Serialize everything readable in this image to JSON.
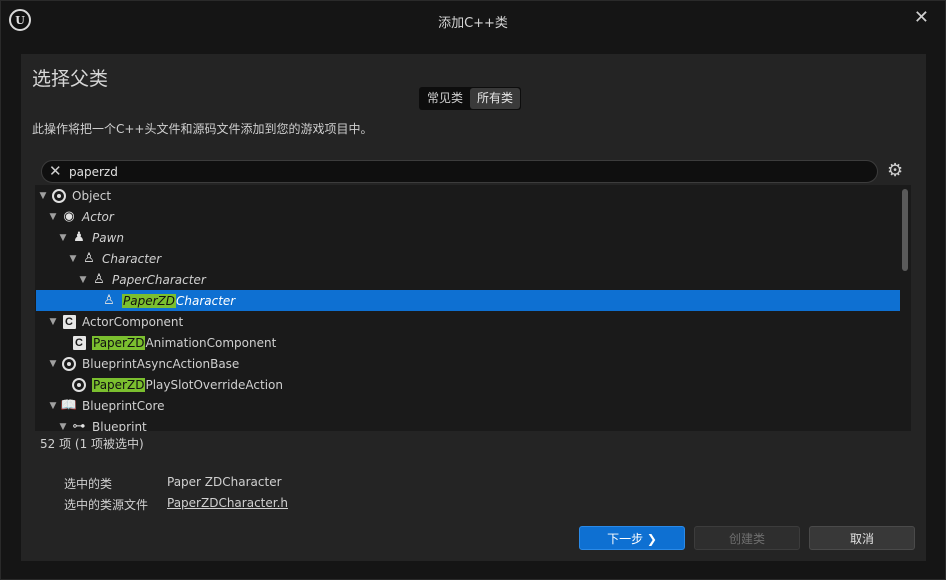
{
  "window": {
    "title": "添加C++类",
    "logo_text": "U"
  },
  "panel": {
    "heading": "选择父类",
    "tabs": [
      {
        "label": "常见类",
        "active": false
      },
      {
        "label": "所有类",
        "active": true
      }
    ],
    "description": "此操作将把一个C++头文件和源码文件添加到您的游戏项目中。"
  },
  "search": {
    "value": "paperzd",
    "placeholder": ""
  },
  "tree": {
    "rows": [
      {
        "pre": "",
        "hl": "",
        "post": "Object"
      },
      {
        "pre": "",
        "hl": "",
        "post": "Actor"
      },
      {
        "pre": "",
        "hl": "",
        "post": "Pawn"
      },
      {
        "pre": "",
        "hl": "",
        "post": "Character"
      },
      {
        "pre": "",
        "hl": "",
        "post": "PaperCharacter"
      },
      {
        "pre": "",
        "hl": "PaperZD",
        "post": "Character"
      },
      {
        "pre": "",
        "hl": "",
        "post": "ActorComponent"
      },
      {
        "pre": "",
        "hl": "PaperZD",
        "post": "AnimationComponent"
      },
      {
        "pre": "",
        "hl": "",
        "post": "BlueprintAsyncActionBase"
      },
      {
        "pre": "",
        "hl": "PaperZD",
        "post": "PlaySlotOverrideAction"
      },
      {
        "pre": "",
        "hl": "",
        "post": "BlueprintCore"
      },
      {
        "pre": "",
        "hl": "",
        "post": "Blueprint"
      }
    ]
  },
  "status": {
    "count": "52 项 (1 项被选中)"
  },
  "info": {
    "selected_class_label": "选中的类",
    "selected_class_value": "Paper ZDCharacter",
    "source_file_label": "选中的类源文件",
    "source_file_value": "PaperZDCharacter.h"
  },
  "buttons": {
    "next": "下一步 ❯",
    "create": "创建类",
    "cancel": "取消"
  },
  "colors": {
    "selection": "#0e70d2",
    "highlight": "#7bbf2f"
  }
}
